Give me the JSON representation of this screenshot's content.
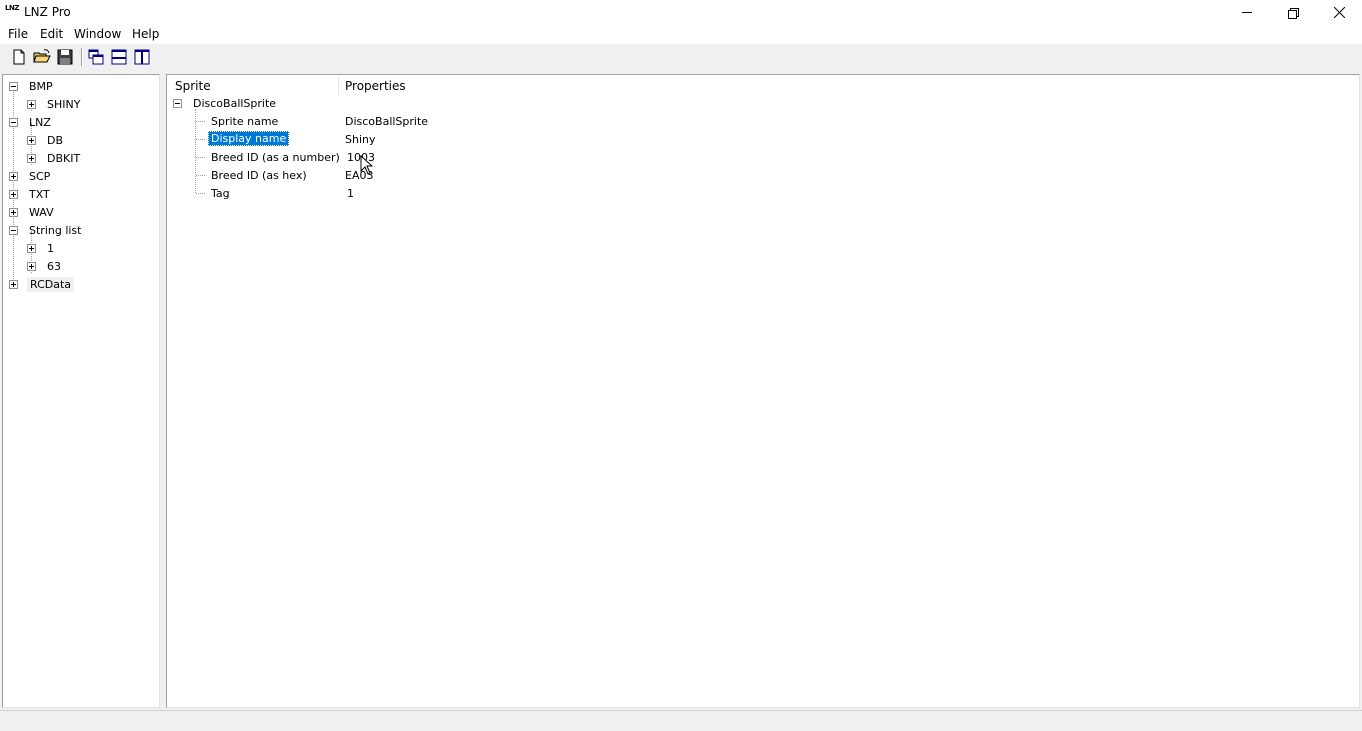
{
  "window": {
    "title": "LNZ Pro",
    "logo_text": "LNZ",
    "controls": [
      "minimize-icon",
      "restore-icon",
      "close-icon"
    ]
  },
  "menu": {
    "file": "File",
    "edit": "Edit",
    "window": "Window",
    "help": "Help"
  },
  "toolbar": {
    "icons": [
      "new-document-icon",
      "open-folder-icon",
      "save-icon",
      "cascade-windows-icon",
      "tile-horizontal-icon",
      "tile-vertical-icon"
    ]
  },
  "tree": {
    "bmp": "BMP",
    "shiny": "SHINY",
    "lnz": "LNZ",
    "db": "DB",
    "dbkit": "DBKIT",
    "scp": "SCP",
    "txt": "TXT",
    "wav": "WAV",
    "string_list": "String list",
    "sl_1": "1",
    "sl_63": "63",
    "rcdata": "RCData"
  },
  "properties": {
    "col_sprite": "Sprite",
    "col_properties": "Properties",
    "root": "DiscoBallSprite",
    "rows": [
      {
        "label": "Sprite name",
        "value": "DiscoBallSprite"
      },
      {
        "label": "Display name",
        "value": "Shiny"
      },
      {
        "label": "Breed ID (as a number)",
        "value": "1003"
      },
      {
        "label": "Breed ID (as hex)",
        "value": "EA03"
      },
      {
        "label": "Tag",
        "value": "1"
      }
    ],
    "selected_row": "Display name"
  },
  "colors": {
    "selection": "#0078d7",
    "panel_bg": "#ffffff",
    "chrome_bg": "#f0f0f0"
  }
}
